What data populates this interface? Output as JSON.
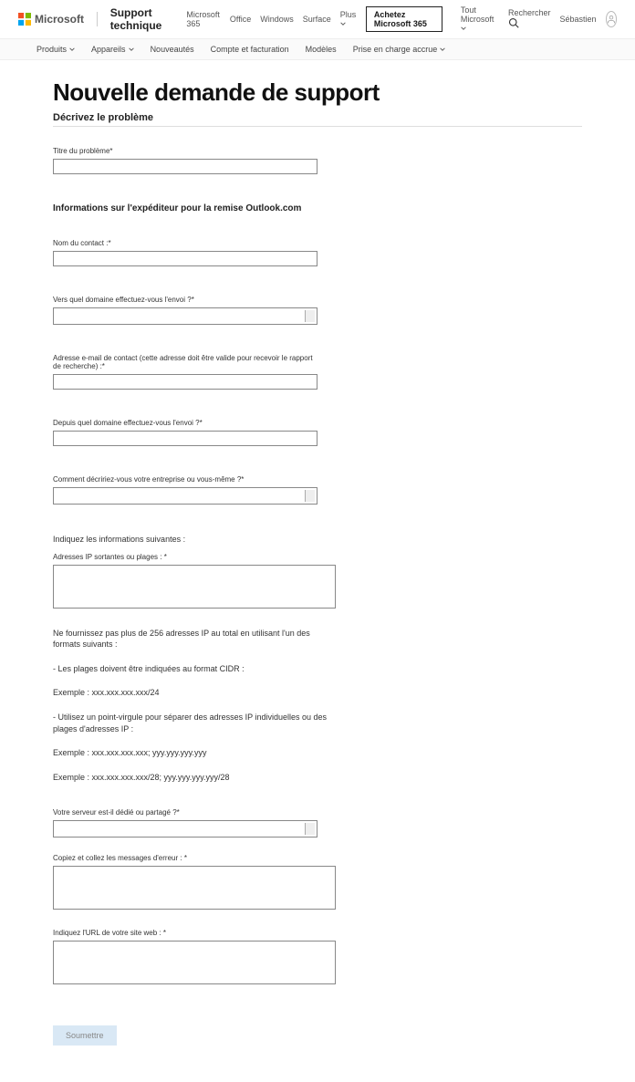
{
  "topbar": {
    "logo_text": "Microsoft",
    "brand": "Support technique",
    "links": [
      "Microsoft 365",
      "Office",
      "Windows",
      "Surface",
      "Plus"
    ],
    "cta": "Achetez Microsoft 365",
    "right": {
      "all": "Tout Microsoft",
      "search": "Rechercher",
      "user": "Sébastien"
    }
  },
  "subnav": {
    "items": [
      "Produits",
      "Appareils",
      "Nouveautés",
      "Compte et facturation",
      "Modèles",
      "Prise en charge accrue"
    ]
  },
  "page": {
    "title": "Nouvelle demande de support",
    "section1": "Décrivez le problème",
    "field_title": "Titre du problème*",
    "section2": "Informations sur l'expéditeur pour la remise Outlook.com",
    "field_contact": "Nom du contact :*",
    "field_domain_to": "Vers quel domaine effectuez-vous l'envoi ?*",
    "field_email": "Adresse e-mail de contact (cette adresse doit être valide pour recevoir le rapport de recherche) :*",
    "field_domain_from": "Depuis quel domaine effectuez-vous l'envoi ?*",
    "field_describe": "Comment décririez-vous votre entreprise ou vous-même ?*",
    "info_following": "Indiquez les informations suivantes :",
    "field_ips": "Adresses IP sortantes ou plages : *",
    "info_max": "Ne fournissez pas plus de 256 adresses IP au total en utilisant l'un des formats suivants :",
    "info_cidr": "- Les plages doivent être indiquées au format CIDR :",
    "info_ex1": "Exemple : xxx.xxx.xxx.xxx/24",
    "info_semi": "- Utilisez un point-virgule pour séparer des adresses IP individuelles ou des plages d'adresses IP :",
    "info_ex2": "Exemple : xxx.xxx.xxx.xxx; yyy.yyy.yyy.yyy",
    "info_ex3": "Exemple : xxx.xxx.xxx.xxx/28; yyy.yyy.yyy.yyy/28",
    "field_server": "Votre serveur est-il dédié ou partagé ?*",
    "field_errors": "Copiez et collez les messages d'erreur : *",
    "field_url": "Indiquez l'URL de votre site web : *",
    "submit": "Soumettre"
  }
}
